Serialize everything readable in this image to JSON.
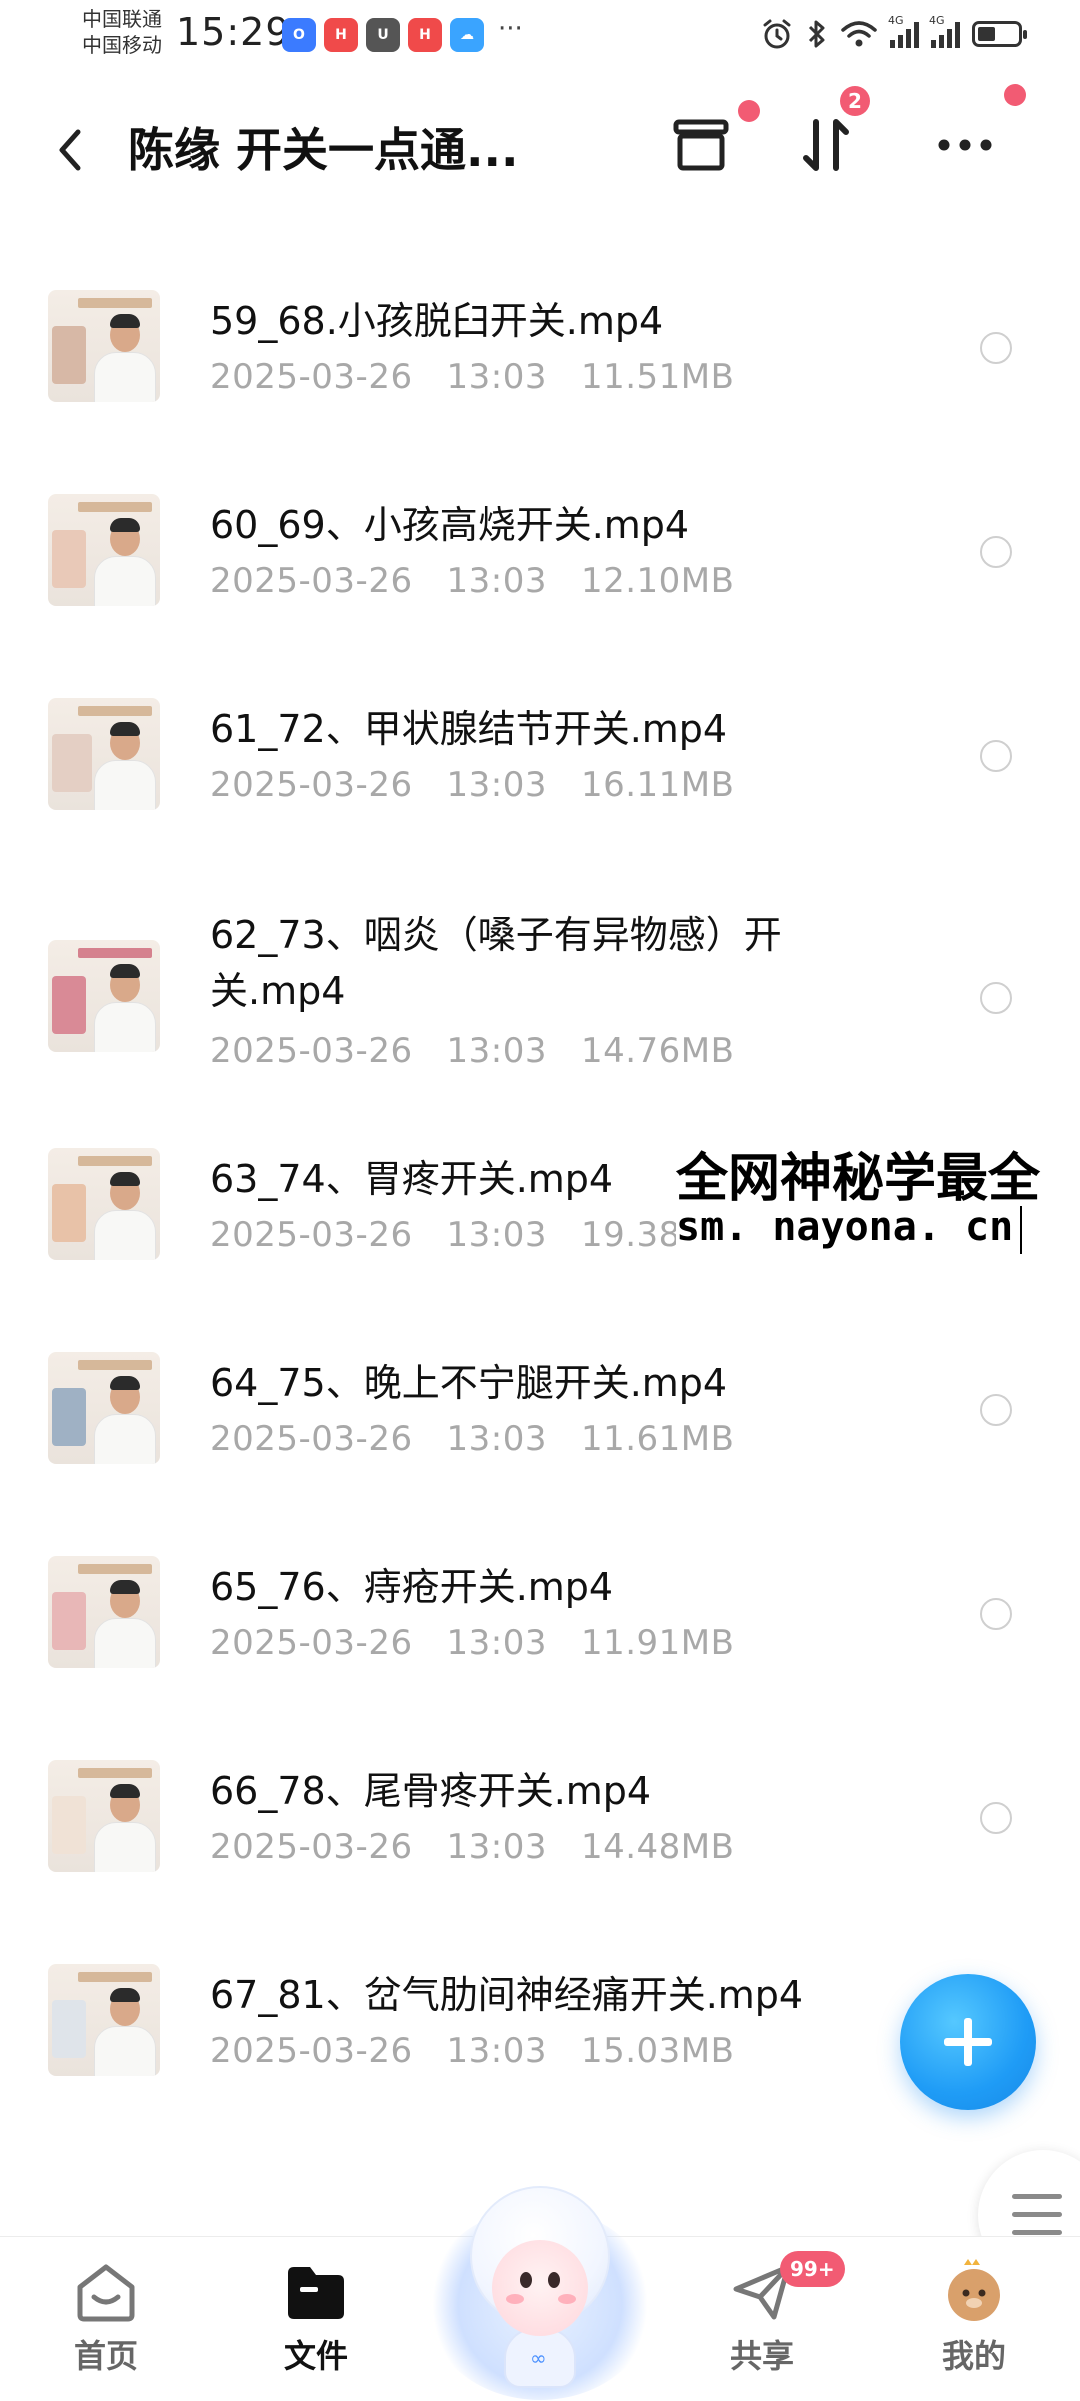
{
  "status_bar": {
    "carrier_1": "中国联通",
    "carrier_2": "中国移动",
    "time": "15:29",
    "more": "···",
    "network_label_1": "4G",
    "network_label_2": "4G",
    "battery_level": 0.45,
    "notification_app_colors": [
      "#3b7bff",
      "#f04a4a",
      "#f04a4a",
      "#3aa4ff"
    ]
  },
  "header": {
    "title": "陈缘 开关一点通...",
    "sort_badge": "2"
  },
  "files": [
    {
      "name": "59_68.小孩脱臼开关.mp4",
      "date": "2025-03-26",
      "time": "13:03",
      "size": "11.51MB"
    },
    {
      "name": "60_69、小孩高烧开关.mp4",
      "date": "2025-03-26",
      "time": "13:03",
      "size": "12.10MB"
    },
    {
      "name": "61_72、甲状腺结节开关.mp4",
      "date": "2025-03-26",
      "time": "13:03",
      "size": "16.11MB"
    },
    {
      "name_line1": "62_73、咽炎（嗓子有异物感）开",
      "name_line2": "关.mp4",
      "date": "2025-03-26",
      "time": "13:03",
      "size": "14.76MB"
    },
    {
      "name": "63_74、胃疼开关.mp4",
      "date": "2025-03-26",
      "time": "13:03",
      "size": "19.38MB"
    },
    {
      "name": "64_75、晚上不宁腿开关.mp4",
      "date": "2025-03-26",
      "time": "13:03",
      "size": "11.61MB"
    },
    {
      "name": "65_76、痔疮开关.mp4",
      "date": "2025-03-26",
      "time": "13:03",
      "size": "11.91MB"
    },
    {
      "name": "66_78、尾骨疼开关.mp4",
      "date": "2025-03-26",
      "time": "13:03",
      "size": "14.48MB"
    },
    {
      "name": "67_81、岔气肋间神经痛开关.mp4",
      "date": "2025-03-26",
      "time": "13:03",
      "size": "15.03MB"
    }
  ],
  "watermark": {
    "line1": "全网神秘学最全",
    "line2": "sm. nayona. cn"
  },
  "bottom_nav": {
    "home": "首页",
    "files": "文件",
    "share": "共享",
    "share_badge": "99+",
    "mine": "我的"
  },
  "colors": {
    "accent": "#1f9cf6",
    "badge": "#f25b73",
    "meta_text": "#a8a8a8"
  }
}
